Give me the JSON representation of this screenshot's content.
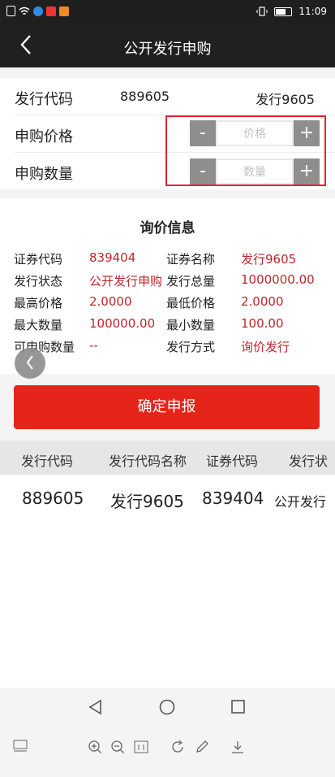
{
  "statusbar": {
    "time": "11:09"
  },
  "nav": {
    "title": "公开发行申购"
  },
  "form": {
    "code_label": "发行代码",
    "code_value": "889605",
    "code_name": "发行9605",
    "price_label": "申购价格",
    "price_placeholder": "价格",
    "qty_label": "申购数量",
    "qty_placeholder": "数量",
    "minus": "-",
    "plus": "+"
  },
  "info": {
    "title": "询价信息",
    "rows": [
      {
        "k1": "证券代码",
        "v1": "839404",
        "k2": "证券名称",
        "v2": "发行9605"
      },
      {
        "k1": "发行状态",
        "v1": "公开发行申购",
        "k2": "发行总量",
        "v2": "1000000.00"
      },
      {
        "k1": "最高价格",
        "v1": "2.0000",
        "k2": "最低价格",
        "v2": "2.0000"
      },
      {
        "k1": "最大数量",
        "v1": "100000.00",
        "k2": "最小数量",
        "v2": "100.00"
      },
      {
        "k1": "可申购数量",
        "v1": "--",
        "k2": "发行方式",
        "v2": "询价发行"
      }
    ]
  },
  "submit_label": "确定申报",
  "table": {
    "headers": [
      "发行代码",
      "发行代码名称",
      "证券代码",
      "发行状"
    ],
    "row": [
      "889605",
      "发行9605",
      "839404",
      "公开发行"
    ]
  },
  "colors": {
    "accent": "#e52519",
    "value_red": "#c0252a",
    "highlight": "#e0262b"
  }
}
